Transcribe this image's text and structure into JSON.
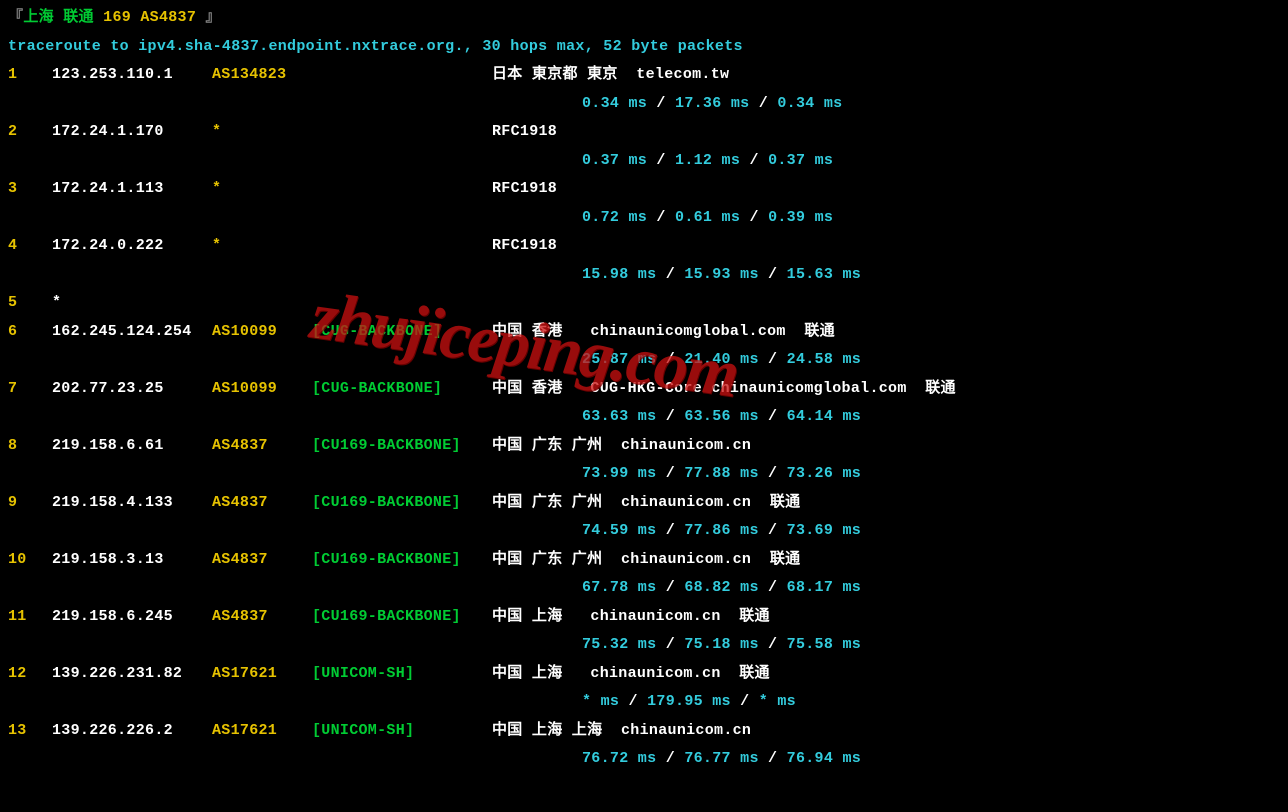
{
  "header": {
    "bracket_l": "『",
    "title_cn": "上海 联通",
    "title_asn": "169 AS4837",
    "bracket_r": "』",
    "cmd": "traceroute to ipv4.sha-4837.endpoint.nxtrace.org., 30 hops max, 52 byte packets"
  },
  "watermark": "zhujiceping.com",
  "hops": [
    {
      "n": "1",
      "ip": "123.253.110.1",
      "asn": "AS134823",
      "tag": "",
      "loc": "日本 東京都 東京",
      "extra": "  telecom.tw",
      "t1": "0.34 ms",
      "t2": "17.36 ms",
      "t3": "0.34 ms"
    },
    {
      "n": "2",
      "ip": "172.24.1.170",
      "asn": "*",
      "tag": "",
      "loc": "RFC1918",
      "extra": "",
      "t1": "0.37 ms",
      "t2": "1.12 ms",
      "t3": "0.37 ms"
    },
    {
      "n": "3",
      "ip": "172.24.1.113",
      "asn": "*",
      "tag": "",
      "loc": "RFC1918",
      "extra": "",
      "t1": "0.72 ms",
      "t2": "0.61 ms",
      "t3": "0.39 ms"
    },
    {
      "n": "4",
      "ip": "172.24.0.222",
      "asn": "*",
      "tag": "",
      "loc": "RFC1918",
      "extra": "",
      "t1": "15.98 ms",
      "t2": "15.93 ms",
      "t3": "15.63 ms"
    },
    {
      "n": "5",
      "ip": "*",
      "asn": "",
      "tag": "",
      "loc": "",
      "extra": "",
      "t1": "",
      "t2": "",
      "t3": ""
    },
    {
      "n": "6",
      "ip": "162.245.124.254",
      "asn": "AS10099",
      "tag": "[CUG-BACKBONE]",
      "loc": "中国 香港",
      "extra": "   chinaunicomglobal.com  联通",
      "t1": "25.87 ms",
      "t2": "21.40 ms",
      "t3": "24.58 ms"
    },
    {
      "n": "7",
      "ip": "202.77.23.25",
      "asn": "AS10099",
      "tag": "[CUG-BACKBONE]",
      "loc": "中国 香港",
      "extra": "   CUG-HKG-Core chinaunicomglobal.com  联通",
      "t1": "63.63 ms",
      "t2": "63.56 ms",
      "t3": "64.14 ms"
    },
    {
      "n": "8",
      "ip": "219.158.6.61",
      "asn": "AS4837",
      "tag": "[CU169-BACKBONE]",
      "loc": "中国 广东 广州",
      "extra": "  chinaunicom.cn",
      "t1": "73.99 ms",
      "t2": "77.88 ms",
      "t3": "73.26 ms"
    },
    {
      "n": "9",
      "ip": "219.158.4.133",
      "asn": "AS4837",
      "tag": "[CU169-BACKBONE]",
      "loc": "中国 广东 广州",
      "extra": "  chinaunicom.cn  联通",
      "t1": "74.59 ms",
      "t2": "77.86 ms",
      "t3": "73.69 ms"
    },
    {
      "n": "10",
      "ip": "219.158.3.13",
      "asn": "AS4837",
      "tag": "[CU169-BACKBONE]",
      "loc": "中国 广东 广州",
      "extra": "  chinaunicom.cn  联通",
      "t1": "67.78 ms",
      "t2": "68.82 ms",
      "t3": "68.17 ms"
    },
    {
      "n": "11",
      "ip": "219.158.6.245",
      "asn": "AS4837",
      "tag": "[CU169-BACKBONE]",
      "loc": "中国 上海",
      "extra": "   chinaunicom.cn  联通",
      "t1": "75.32 ms",
      "t2": "75.18 ms",
      "t3": "75.58 ms"
    },
    {
      "n": "12",
      "ip": "139.226.231.82",
      "asn": "AS17621",
      "tag": "[UNICOM-SH]",
      "loc": "中国 上海",
      "extra": "   chinaunicom.cn  联通",
      "t1": "* ms",
      "t2": "179.95 ms",
      "t3": "* ms"
    },
    {
      "n": "13",
      "ip": "139.226.226.2",
      "asn": "AS17621",
      "tag": "[UNICOM-SH]",
      "loc": "中国 上海 上海",
      "extra": "  chinaunicom.cn",
      "t1": "76.72 ms",
      "t2": "76.77 ms",
      "t3": "76.94 ms"
    }
  ],
  "sep": " / "
}
